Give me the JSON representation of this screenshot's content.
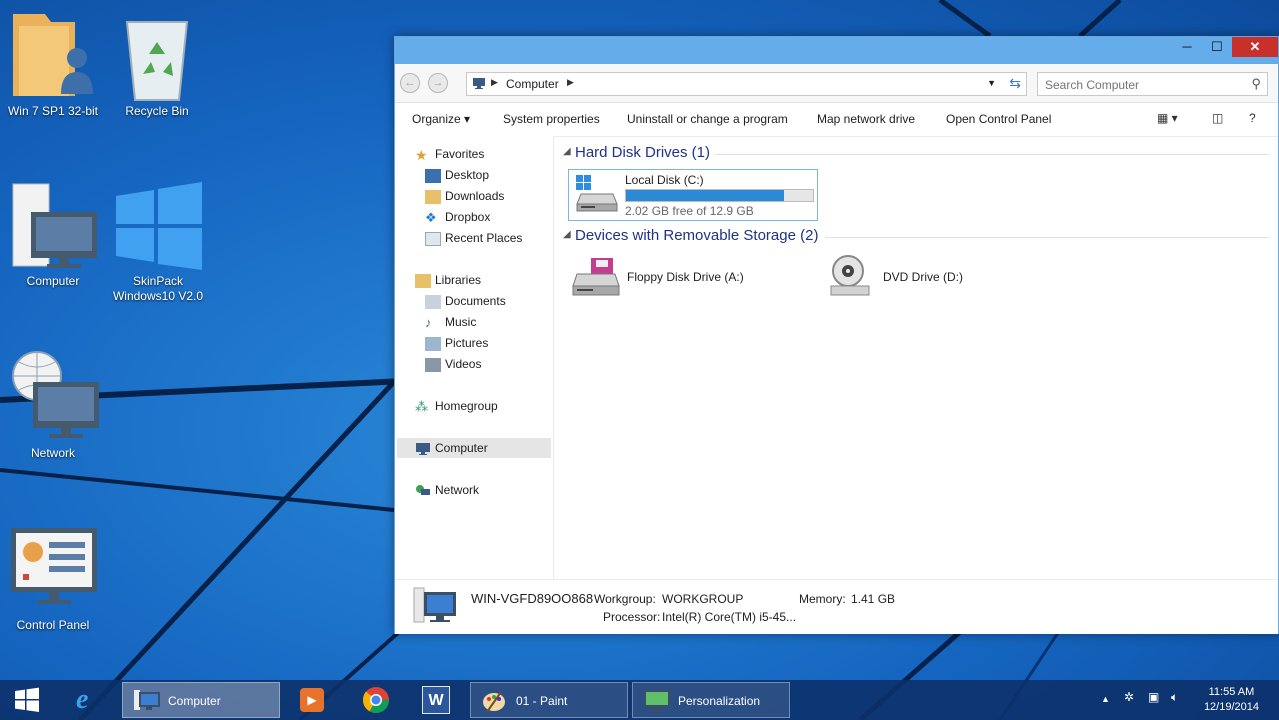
{
  "desktop": {
    "icons": [
      {
        "label": "Win 7 SP1 32-bit"
      },
      {
        "label": "Recycle Bin"
      },
      {
        "label": "Computer"
      },
      {
        "label_line1": "SkinPack",
        "label_line2": "Windows10 V2.0"
      },
      {
        "label": "Network"
      },
      {
        "label": "Control Panel"
      }
    ]
  },
  "window": {
    "controls": {
      "minimize": "─",
      "maximize": "☐",
      "close": "✕"
    },
    "address": {
      "crumb": "Computer",
      "back": "←",
      "forward": "→"
    },
    "search": {
      "placeholder": "Search Computer"
    },
    "toolbar": {
      "organize": "Organize ▾",
      "system_properties": "System properties",
      "uninstall": "Uninstall or change a program",
      "map_drive": "Map network drive",
      "control_panel": "Open Control Panel",
      "help": "?"
    },
    "nav": {
      "favorites": "Favorites",
      "desktop": "Desktop",
      "downloads": "Downloads",
      "dropbox": "Dropbox",
      "recent": "Recent Places",
      "libraries": "Libraries",
      "documents": "Documents",
      "music": "Music",
      "pictures": "Pictures",
      "videos": "Videos",
      "homegroup": "Homegroup",
      "computer": "Computer",
      "network": "Network"
    },
    "content": {
      "hard_disk_group": "Hard Disk Drives (1)",
      "disk_c": {
        "name": "Local Disk (C:)",
        "free": "2.02 GB free of 12.9 GB",
        "used_fraction": 0.843
      },
      "removable_group": "Devices with Removable Storage (2)",
      "floppy": "Floppy Disk Drive (A:)",
      "dvd": "DVD Drive (D:)"
    },
    "details": {
      "computer_name": "WIN-VGFD89OO868",
      "workgroup_label": "Workgroup:",
      "workgroup": "WORKGROUP",
      "memory_label": "Memory:",
      "memory": "1.41 GB",
      "processor_label": "Processor:",
      "processor": "Intel(R) Core(TM) i5-45..."
    }
  },
  "taskbar": {
    "computer": "Computer",
    "paint": "01 - Paint",
    "personalization": "Personalization",
    "tray_up": "▲",
    "time": "11:55 AM",
    "date": "12/19/2014"
  },
  "colors": {
    "accent": "#2b8ad3",
    "close": "#c7302b",
    "titlebar": "#65acea"
  }
}
